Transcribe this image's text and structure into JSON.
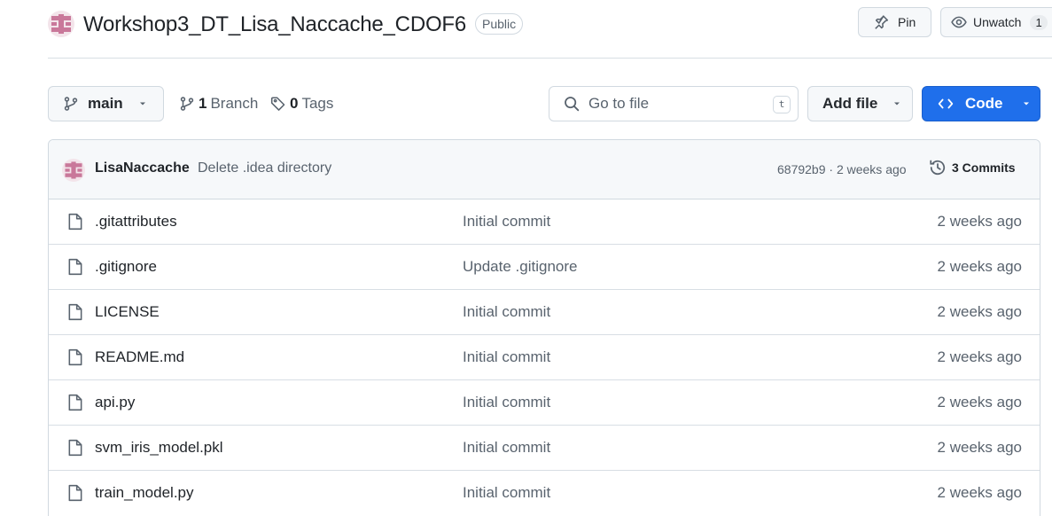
{
  "repo": {
    "name": "Workshop3_DT_Lisa_Naccache_CDOF6",
    "visibility": "Public"
  },
  "actions": {
    "pin_label": "Pin",
    "unwatch_label": "Unwatch",
    "watch_count": "1"
  },
  "toolbar": {
    "branch": "main",
    "branches_count": "1",
    "branches_label": "Branch",
    "tags_count": "0",
    "tags_label": "Tags",
    "search_placeholder": "Go to file",
    "search_shortcut": "t",
    "add_file_label": "Add file",
    "code_label": "Code"
  },
  "latest_commit": {
    "author": "LisaNaccache",
    "message": "Delete .idea directory",
    "meta": "68792b9 · 2 weeks ago",
    "commits_label": "3 Commits"
  },
  "files": [
    {
      "name": ".gitattributes",
      "commit": "Initial commit",
      "age": "2 weeks ago"
    },
    {
      "name": ".gitignore",
      "commit": "Update .gitignore",
      "age": "2 weeks ago"
    },
    {
      "name": "LICENSE",
      "commit": "Initial commit",
      "age": "2 weeks ago"
    },
    {
      "name": "README.md",
      "commit": "Initial commit",
      "age": "2 weeks ago"
    },
    {
      "name": "api.py",
      "commit": "Initial commit",
      "age": "2 weeks ago"
    },
    {
      "name": "svm_iris_model.pkl",
      "commit": "Initial commit",
      "age": "2 weeks ago"
    },
    {
      "name": "train_model.py",
      "commit": "Initial commit",
      "age": "2 weeks ago"
    }
  ],
  "colors": {
    "primary_button": "#1f6feb",
    "avatar_pink": "#c9789a"
  }
}
